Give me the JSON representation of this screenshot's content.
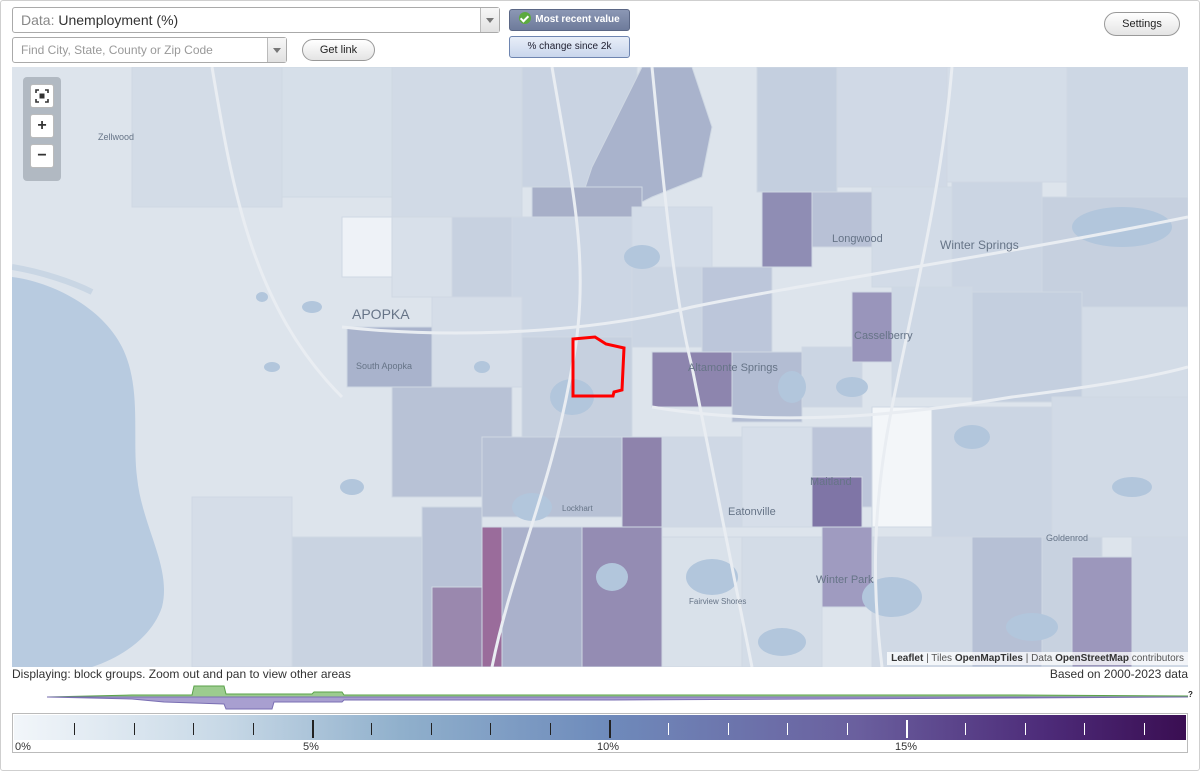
{
  "controls": {
    "data_prefix": "Data:",
    "data_value": "Unemployment (%)",
    "search_placeholder": "Find City, State, County or Zip Code",
    "get_link": "Get link",
    "settings": "Settings",
    "mode_recent": "Most recent value",
    "mode_change": "% change since 2k"
  },
  "map": {
    "places": [
      "Zellwood",
      "APOPKA",
      "South Apopka",
      "Longwood",
      "Winter Springs",
      "Casselberry",
      "Altamonte Springs",
      "Maitland",
      "Lockhart",
      "Eatonville",
      "Goldenrod",
      "Winter Park",
      "Fairview Shores"
    ],
    "zoom": {
      "fit": "fit-icon",
      "in": "+",
      "out": "−"
    },
    "colors": {
      "water": "#b8cbe0",
      "land": "#dde4ec",
      "highlight": "#ff0000"
    }
  },
  "attribution": {
    "leaflet": "Leaflet",
    "sep1": " | Tiles ",
    "tiles": "OpenMapTiles",
    "sep2": " | Data ",
    "data": "OpenStreetMap",
    "tail": " contributors"
  },
  "status": {
    "displaying": "Displaying: block groups. Zoom out and pan to view other areas",
    "based_on": "Based on 2000-2023 data"
  },
  "legend": {
    "labels": [
      "0%",
      "5%",
      "10%",
      "15%"
    ],
    "help": "?"
  }
}
